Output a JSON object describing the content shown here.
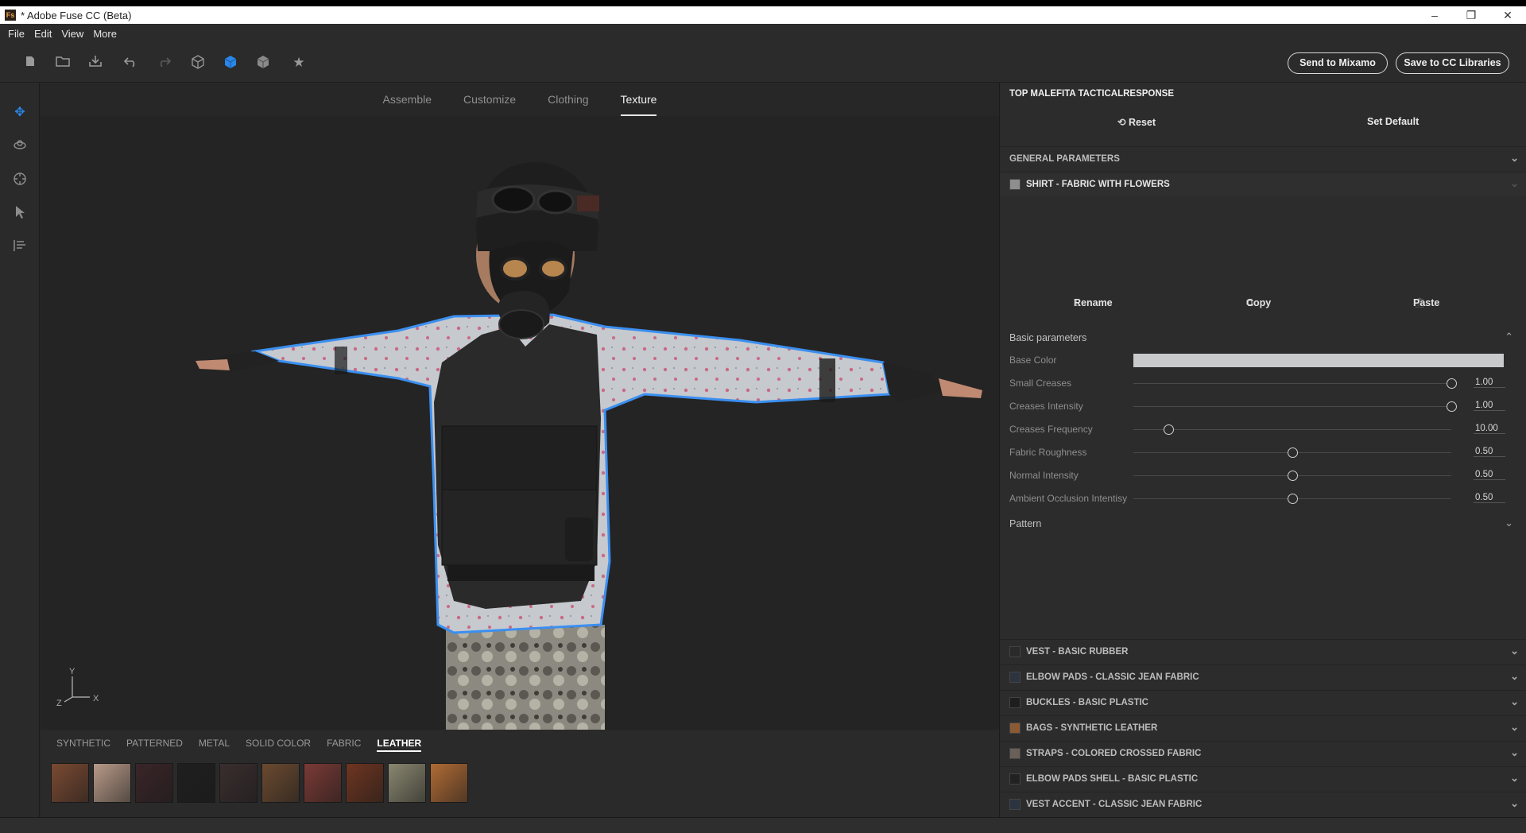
{
  "window": {
    "title": "* Adobe Fuse CC (Beta)",
    "app_icon": "Fs",
    "controls": [
      "–",
      "❐",
      "✕"
    ]
  },
  "menu": [
    "File",
    "Edit",
    "View",
    "More"
  ],
  "toolbar": {
    "icons": [
      "new-icon",
      "open-icon",
      "import-icon",
      "undo-icon",
      "redo-icon",
      "wireframe-cube-icon",
      "solid-cube-icon",
      "textured-cube-icon",
      "favorite-star-icon"
    ],
    "send_mixamo": "Send to Mixamo",
    "save_cc": "Save to CC Libraries",
    "accent": "#2a86e8"
  },
  "left_tools": [
    "move-icon",
    "orbit-icon",
    "target-icon",
    "pointer-icon",
    "list-tool-icon"
  ],
  "tabs": [
    {
      "label": "Assemble",
      "active": false
    },
    {
      "label": "Customize",
      "active": false
    },
    {
      "label": "Clothing",
      "active": false
    },
    {
      "label": "Texture",
      "active": true
    }
  ],
  "axes": {
    "y": "Y",
    "z": "Z",
    "x": "X"
  },
  "material_tabs": [
    {
      "label": "SYNTHETIC",
      "active": false
    },
    {
      "label": "PATTERNED",
      "active": false
    },
    {
      "label": "METAL",
      "active": false
    },
    {
      "label": "SOLID COLOR",
      "active": false
    },
    {
      "label": "FABRIC",
      "active": false
    },
    {
      "label": "LEATHER",
      "active": true
    }
  ],
  "swatches": [
    "#7a4a32",
    "#b89a88",
    "#3a2528",
    "#1f1f1f",
    "#3a2e2e",
    "#6b4a30",
    "#7a3a35",
    "#6e3520",
    "#8a8770",
    "#b06b35"
  ],
  "panel": {
    "title": "TOP MALEFITA TACTICALRESPONSE",
    "reset": "Reset",
    "set_default": "Set Default",
    "general": "GENERAL PARAMETERS",
    "selected_material": "SHIRT - FABRIC WITH FLOWERS",
    "rename": "Rename",
    "copy": "Copy",
    "paste": "Paste",
    "basic": "Basic parameters",
    "base_color_label": "Base Color",
    "base_color": "#c9cacc",
    "params": [
      {
        "label": "Small Creases",
        "value": "1.00",
        "level": 1.0
      },
      {
        "label": "Creases Intensity",
        "value": "1.00",
        "level": 1.0
      },
      {
        "label": "Creases Frequency",
        "value": "10.00",
        "level": 0.11
      },
      {
        "label": "Fabric Roughness",
        "value": "0.50",
        "level": 0.5
      },
      {
        "label": "Normal Intensity",
        "value": "0.50",
        "level": 0.5
      },
      {
        "label": "Ambient Occlusion Intentisy",
        "value": "0.50",
        "level": 0.5
      }
    ],
    "pattern": "Pattern",
    "materials": [
      {
        "label": "VEST - BASIC RUBBER",
        "color": "#2a2a2a"
      },
      {
        "label": "ELBOW PADS - CLASSIC JEAN FABRIC",
        "color": "#2c3440"
      },
      {
        "label": "BUCKLES - BASIC PLASTIC",
        "color": "#1e1e1e"
      },
      {
        "label": "BAGS - SYNTHETIC LEATHER",
        "color": "#8a5a35"
      },
      {
        "label": "STRAPS - COLORED CROSSED FABRIC",
        "color": "#6a6058"
      },
      {
        "label": "ELBOW PADS SHELL - BASIC PLASTIC",
        "color": "#222"
      },
      {
        "label": "VEST ACCENT - CLASSIC JEAN FABRIC",
        "color": "#2c3440"
      }
    ]
  }
}
